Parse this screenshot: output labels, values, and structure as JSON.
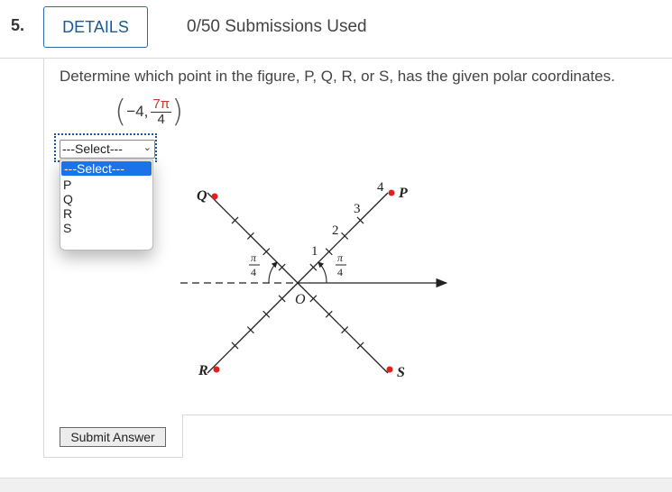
{
  "question": {
    "number": "5.",
    "details_label": "DETAILS",
    "submissions": "0/50 Submissions Used",
    "prompt": "Determine which point in the figure, P, Q, R, or S, has the given polar coordinates.",
    "coords": {
      "r": "−4,",
      "angle_num": "7π",
      "angle_den": "4"
    }
  },
  "select": {
    "value": "---Select---",
    "options": [
      "---Select---",
      "P",
      "Q",
      "R",
      "S"
    ]
  },
  "figure": {
    "points": [
      "P",
      "Q",
      "R",
      "S"
    ],
    "origin": "O",
    "ticks": [
      "1",
      "2",
      "3",
      "4"
    ],
    "angle_label_num": "π",
    "angle_label_den": "4",
    "point_color": "#e02020"
  },
  "submit_label": "Submit Answer"
}
